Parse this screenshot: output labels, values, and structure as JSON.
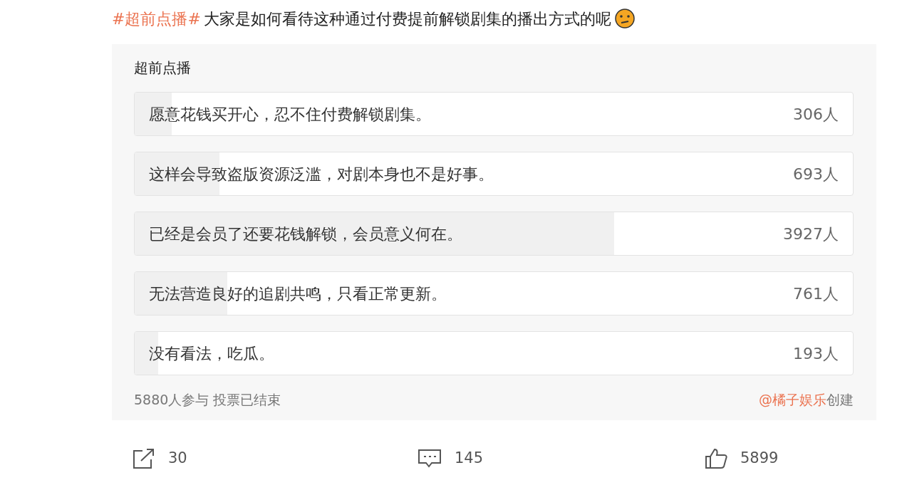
{
  "post": {
    "topic": "#超前点播#",
    "text": "大家是如何看待这种通过付费提前解锁剧集的播出方式的呢"
  },
  "poll": {
    "title": "超前点播",
    "options": [
      {
        "label": "愿意花钱买开心，忍不住付费解锁剧集。",
        "count": "306人",
        "level": 0.052
      },
      {
        "label": "这样会导致盗版资源泛滥，对剧本身也不是好事。",
        "count": "693人",
        "level": 0.118
      },
      {
        "label": "已经是会员了还要花钱解锁，会员意义何在。",
        "count": "3927人",
        "level": 0.668
      },
      {
        "label": "无法营造良好的追剧共鸣，只看正常更新。",
        "count": "761人",
        "level": 0.129
      },
      {
        "label": "没有看法，吃瓜。",
        "count": "193人",
        "level": 0.033
      }
    ],
    "summary": "5880人参与 投票已结束",
    "creator": "@橘子娱乐",
    "created": "创建"
  },
  "actions": [
    {
      "kind": "share",
      "count": "30"
    },
    {
      "kind": "comment",
      "count": "145"
    },
    {
      "kind": "like",
      "count": "5899"
    }
  ]
}
